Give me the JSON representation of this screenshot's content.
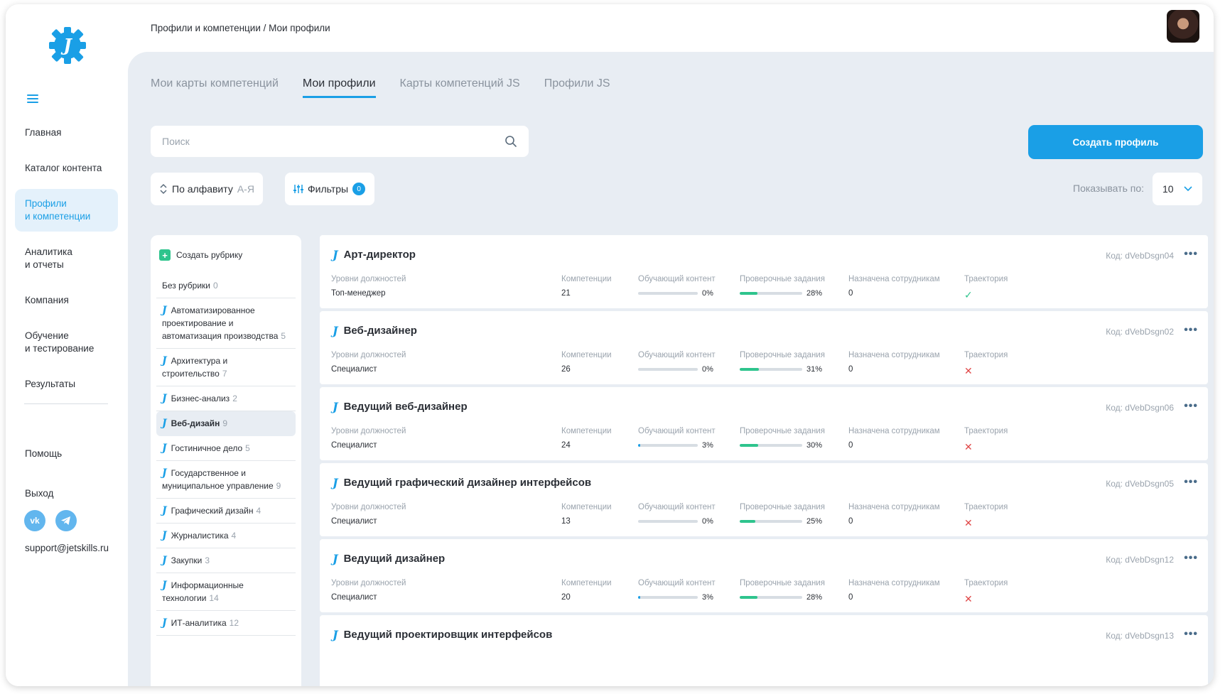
{
  "sidebar": {
    "nav": [
      "Главная",
      "Каталог контента",
      "Профили\nи компетенции",
      "Аналитика\nи отчеты",
      "Компания",
      "Обучение\nи тестирование",
      "Результаты"
    ],
    "nav_bottom": [
      "Помощь",
      "Выход"
    ],
    "social": [
      "vk-icon",
      "telegram-icon"
    ],
    "support_email": "support@jetskills.ru"
  },
  "header": {
    "breadcrumb": "Профили и компетенции / Мои профили"
  },
  "tabs": [
    "Мои карты компетенций",
    "Мои профили",
    "Карты компетенций JS",
    "Профили JS"
  ],
  "search": {
    "placeholder": "Поиск"
  },
  "create_button": "Создать профиль",
  "sort": {
    "label": "По алфавиту",
    "order": "А-Я"
  },
  "filters": {
    "label": "Фильтры",
    "count": "0"
  },
  "per_page": {
    "label": "Показывать по:",
    "value": "10"
  },
  "rubrics": {
    "create_label": "Создать рубрику",
    "items": [
      {
        "name": "Без рубрики",
        "count": "0",
        "icon": false
      },
      {
        "name": "Автоматизированное проектирование и автоматизация производства",
        "count": "5",
        "icon": true
      },
      {
        "name": "Архитектура и строительство",
        "count": "7",
        "icon": true
      },
      {
        "name": "Бизнес-анализ",
        "count": "2",
        "icon": true
      },
      {
        "name": "Веб-дизайн",
        "count": "9",
        "icon": true,
        "active": true
      },
      {
        "name": "Гостиничное дело",
        "count": "5",
        "icon": true
      },
      {
        "name": "Государственное и муниципальное управление",
        "count": "9",
        "icon": true
      },
      {
        "name": "Графический дизайн",
        "count": "4",
        "icon": true
      },
      {
        "name": "Журналистика",
        "count": "4",
        "icon": true
      },
      {
        "name": "Закупки",
        "count": "3",
        "icon": true
      },
      {
        "name": "Информационные технологии",
        "count": "14",
        "icon": true
      },
      {
        "name": "ИТ-аналитика",
        "count": "12",
        "icon": true
      }
    ]
  },
  "columns": {
    "levels": "Уровни должностей",
    "competencies": "Компетенции",
    "content": "Обучающий контент",
    "tasks": "Проверочные задания",
    "assigned": "Назначена сотрудникам",
    "trajectory": "Траектория"
  },
  "colors": {
    "accent": "#1a9fe6",
    "success": "#2ec48d",
    "error": "#e04848"
  },
  "profiles": [
    {
      "title": "Арт-директор",
      "code": "Код: dVebDsgn04",
      "level": "Топ-менеджер",
      "competencies": "21",
      "content_pct": 0,
      "content_label": "0%",
      "tasks_pct": 28,
      "tasks_label": "28%",
      "assigned": "0",
      "trajectory": true
    },
    {
      "title": "Веб-дизайнер",
      "code": "Код: dVebDsgn02",
      "level": "Специалист",
      "competencies": "26",
      "content_pct": 0,
      "content_label": "0%",
      "tasks_pct": 31,
      "tasks_label": "31%",
      "assigned": "0",
      "trajectory": false
    },
    {
      "title": "Ведущий веб-дизайнер",
      "code": "Код: dVebDsgn06",
      "level": "Специалист",
      "competencies": "24",
      "content_pct": 3,
      "content_label": "3%",
      "tasks_pct": 30,
      "tasks_label": "30%",
      "assigned": "0",
      "trajectory": false
    },
    {
      "title": "Ведущий графический дизайнер интерфейсов",
      "code": "Код: dVebDsgn05",
      "level": "Специалист",
      "competencies": "13",
      "content_pct": 0,
      "content_label": "0%",
      "tasks_pct": 25,
      "tasks_label": "25%",
      "assigned": "0",
      "trajectory": false
    },
    {
      "title": "Ведущий дизайнер",
      "code": "Код: dVebDsgn12",
      "level": "Специалист",
      "competencies": "20",
      "content_pct": 3,
      "content_label": "3%",
      "tasks_pct": 28,
      "tasks_label": "28%",
      "assigned": "0",
      "trajectory": false
    },
    {
      "title": "Ведущий проектировщик интерфейсов",
      "code": "Код: dVebDsgn13",
      "partial": true
    }
  ]
}
